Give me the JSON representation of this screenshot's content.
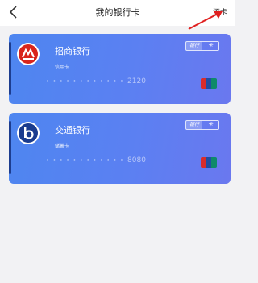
{
  "header": {
    "title": "我的银行卡",
    "add_label": "添卡"
  },
  "cards": [
    {
      "bank": "招商银行",
      "type": "信用卡",
      "badge": [
        "银行",
        "卡"
      ],
      "number_masked": "• • • •   • • • •   • • • •",
      "number_tail": "2120",
      "network_icon": "unionpay-icon",
      "logo_icon": "cmb-logo-icon",
      "logo_color": "#d9251c"
    },
    {
      "bank": "交通银行",
      "type": "储蓄卡",
      "badge": [
        "银行",
        "卡"
      ],
      "number_masked": "• • • •   • • • •   • • • •",
      "number_tail": "8080",
      "network_icon": "unionpay-icon",
      "logo_icon": "bocom-logo-icon",
      "logo_color": "#1a3c8e"
    }
  ],
  "colors": {
    "card_gradient_start": "#4e86f0",
    "card_gradient_end": "#6a78ef",
    "arrow": "#e02020"
  }
}
